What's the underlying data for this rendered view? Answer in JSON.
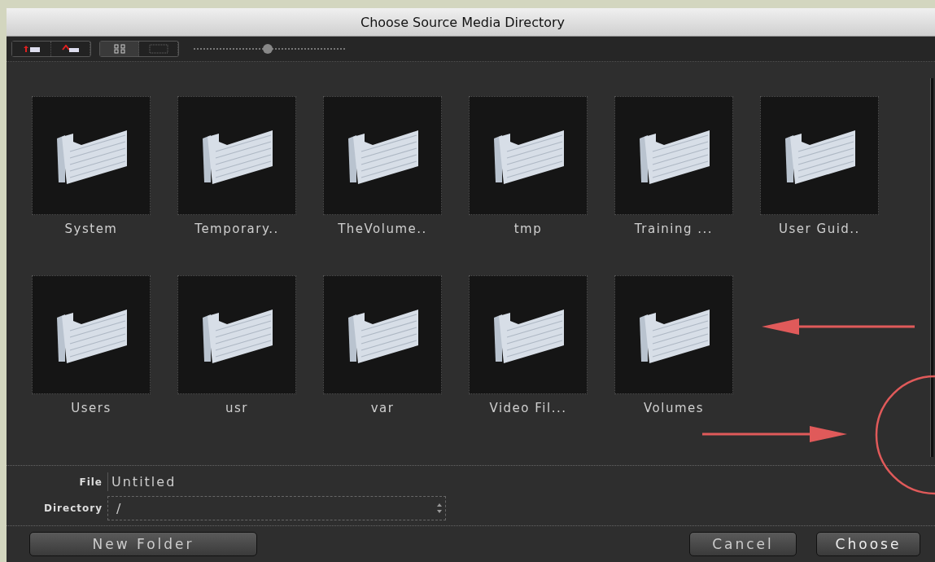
{
  "window": {
    "title": "Choose Source Media Directory"
  },
  "toolbar": {
    "nav_buttons": [
      {
        "kind": "back"
      },
      {
        "kind": "home"
      }
    ],
    "view_buttons": [
      {
        "kind": "icons",
        "selected": true
      },
      {
        "kind": "list",
        "selected": false
      }
    ],
    "zoom_slider": {
      "level": 0.49
    }
  },
  "folders": [
    {
      "name": "System"
    },
    {
      "name": "Temporary.."
    },
    {
      "name": "TheVolume.."
    },
    {
      "name": "tmp"
    },
    {
      "name": "Training ..."
    },
    {
      "name": "User Guid.."
    },
    {
      "name": "Users"
    },
    {
      "name": "usr"
    },
    {
      "name": "var"
    },
    {
      "name": "Video Fil..."
    },
    {
      "name": "Volumes"
    }
  ],
  "file": {
    "label": "File",
    "value": "Untitled"
  },
  "directory": {
    "label": "Directory",
    "value": "/"
  },
  "buttons": {
    "new_folder": "New Folder",
    "cancel": "Cancel",
    "choose": "Choose"
  }
}
